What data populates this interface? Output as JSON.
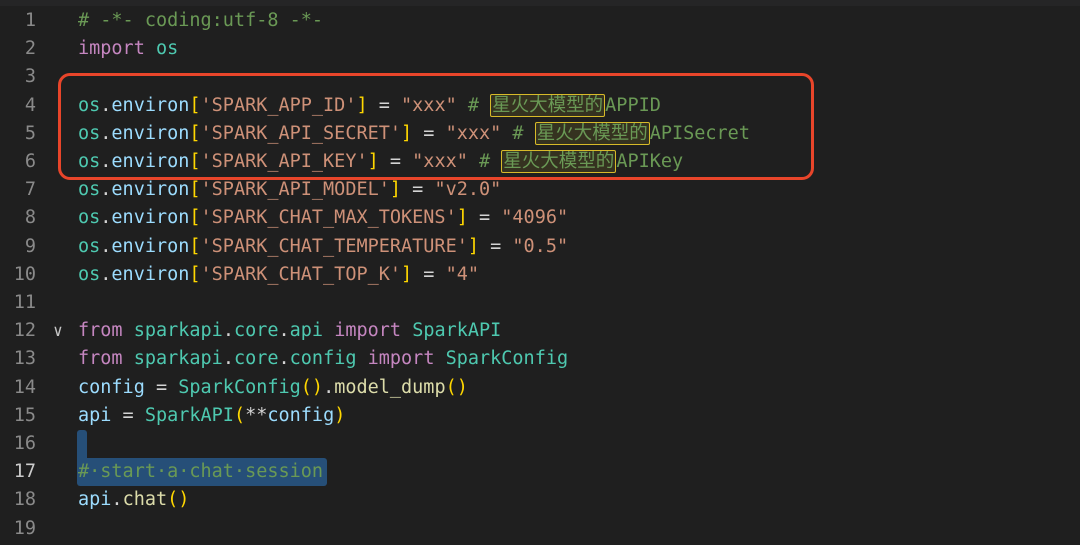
{
  "editor": {
    "lines": [
      {
        "num": "1",
        "tokens": [
          {
            "t": "# -*- coding:utf-8 -*-",
            "c": "cm"
          }
        ]
      },
      {
        "num": "2",
        "tokens": [
          {
            "t": "import",
            "c": "kw"
          },
          {
            "t": " ",
            "c": "op"
          },
          {
            "t": "os",
            "c": "cls"
          }
        ]
      },
      {
        "num": "3",
        "tokens": []
      },
      {
        "num": "4",
        "tokens": [
          {
            "t": "os",
            "c": "cls"
          },
          {
            "t": ".",
            "c": "op"
          },
          {
            "t": "environ",
            "c": "id"
          },
          {
            "t": "[",
            "c": "br1"
          },
          {
            "t": "'SPARK_APP_ID'",
            "c": "str"
          },
          {
            "t": "]",
            "c": "br1"
          },
          {
            "t": " = ",
            "c": "op"
          },
          {
            "t": "\"xxx\"",
            "c": "str"
          },
          {
            "t": " # ",
            "c": "cm"
          },
          {
            "t": "星火大模型的",
            "c": "cm hl"
          },
          {
            "t": "APPID",
            "c": "cm"
          }
        ]
      },
      {
        "num": "5",
        "tokens": [
          {
            "t": "os",
            "c": "cls"
          },
          {
            "t": ".",
            "c": "op"
          },
          {
            "t": "environ",
            "c": "id"
          },
          {
            "t": "[",
            "c": "br1"
          },
          {
            "t": "'SPARK_API_SECRET'",
            "c": "str"
          },
          {
            "t": "]",
            "c": "br1"
          },
          {
            "t": " = ",
            "c": "op"
          },
          {
            "t": "\"xxx\"",
            "c": "str"
          },
          {
            "t": " # ",
            "c": "cm"
          },
          {
            "t": "星火大模型的",
            "c": "cm hl"
          },
          {
            "t": "APISecret",
            "c": "cm"
          }
        ]
      },
      {
        "num": "6",
        "tokens": [
          {
            "t": "os",
            "c": "cls"
          },
          {
            "t": ".",
            "c": "op"
          },
          {
            "t": "environ",
            "c": "id"
          },
          {
            "t": "[",
            "c": "br1"
          },
          {
            "t": "'SPARK_API_KEY'",
            "c": "str"
          },
          {
            "t": "]",
            "c": "br1"
          },
          {
            "t": " = ",
            "c": "op"
          },
          {
            "t": "\"xxx\"",
            "c": "str"
          },
          {
            "t": " # ",
            "c": "cm"
          },
          {
            "t": "星火大模型的",
            "c": "cm hl"
          },
          {
            "t": "APIKey",
            "c": "cm"
          }
        ]
      },
      {
        "num": "7",
        "tokens": [
          {
            "t": "os",
            "c": "cls"
          },
          {
            "t": ".",
            "c": "op"
          },
          {
            "t": "environ",
            "c": "id"
          },
          {
            "t": "[",
            "c": "br1"
          },
          {
            "t": "'SPARK_API_MODEL'",
            "c": "str"
          },
          {
            "t": "]",
            "c": "br1"
          },
          {
            "t": " = ",
            "c": "op"
          },
          {
            "t": "\"v2.0\"",
            "c": "str"
          }
        ]
      },
      {
        "num": "8",
        "tokens": [
          {
            "t": "os",
            "c": "cls"
          },
          {
            "t": ".",
            "c": "op"
          },
          {
            "t": "environ",
            "c": "id"
          },
          {
            "t": "[",
            "c": "br1"
          },
          {
            "t": "'SPARK_CHAT_MAX_TOKENS'",
            "c": "str"
          },
          {
            "t": "]",
            "c": "br1"
          },
          {
            "t": " = ",
            "c": "op"
          },
          {
            "t": "\"4096\"",
            "c": "str"
          }
        ]
      },
      {
        "num": "9",
        "tokens": [
          {
            "t": "os",
            "c": "cls"
          },
          {
            "t": ".",
            "c": "op"
          },
          {
            "t": "environ",
            "c": "id"
          },
          {
            "t": "[",
            "c": "br1"
          },
          {
            "t": "'SPARK_CHAT_TEMPERATURE'",
            "c": "str"
          },
          {
            "t": "]",
            "c": "br1"
          },
          {
            "t": " = ",
            "c": "op"
          },
          {
            "t": "\"0.5\"",
            "c": "str"
          }
        ]
      },
      {
        "num": "10",
        "tokens": [
          {
            "t": "os",
            "c": "cls"
          },
          {
            "t": ".",
            "c": "op"
          },
          {
            "t": "environ",
            "c": "id"
          },
          {
            "t": "[",
            "c": "br1"
          },
          {
            "t": "'SPARK_CHAT_TOP_K'",
            "c": "str"
          },
          {
            "t": "]",
            "c": "br1"
          },
          {
            "t": " = ",
            "c": "op"
          },
          {
            "t": "\"4\"",
            "c": "str"
          }
        ]
      },
      {
        "num": "11",
        "tokens": []
      },
      {
        "num": "12",
        "fold": "∨",
        "tokens": [
          {
            "t": "from",
            "c": "kw"
          },
          {
            "t": " ",
            "c": "op"
          },
          {
            "t": "sparkapi",
            "c": "cls"
          },
          {
            "t": ".",
            "c": "op"
          },
          {
            "t": "core",
            "c": "cls"
          },
          {
            "t": ".",
            "c": "op"
          },
          {
            "t": "api",
            "c": "cls"
          },
          {
            "t": " ",
            "c": "op"
          },
          {
            "t": "import",
            "c": "kw"
          },
          {
            "t": " ",
            "c": "op"
          },
          {
            "t": "SparkAPI",
            "c": "cls"
          }
        ]
      },
      {
        "num": "13",
        "tokens": [
          {
            "t": "from",
            "c": "kw"
          },
          {
            "t": " ",
            "c": "op"
          },
          {
            "t": "sparkapi",
            "c": "cls"
          },
          {
            "t": ".",
            "c": "op"
          },
          {
            "t": "core",
            "c": "cls"
          },
          {
            "t": ".",
            "c": "op"
          },
          {
            "t": "config",
            "c": "cls"
          },
          {
            "t": " ",
            "c": "op"
          },
          {
            "t": "import",
            "c": "kw"
          },
          {
            "t": " ",
            "c": "op"
          },
          {
            "t": "SparkConfig",
            "c": "cls"
          }
        ]
      },
      {
        "num": "14",
        "tokens": [
          {
            "t": "config",
            "c": "id"
          },
          {
            "t": " = ",
            "c": "op"
          },
          {
            "t": "SparkConfig",
            "c": "cls"
          },
          {
            "t": "()",
            "c": "br1"
          },
          {
            "t": ".",
            "c": "op"
          },
          {
            "t": "model_dump",
            "c": "fn"
          },
          {
            "t": "()",
            "c": "br1"
          }
        ]
      },
      {
        "num": "15",
        "tokens": [
          {
            "t": "api",
            "c": "id"
          },
          {
            "t": " = ",
            "c": "op"
          },
          {
            "t": "SparkAPI",
            "c": "cls"
          },
          {
            "t": "(",
            "c": "br1"
          },
          {
            "t": "**",
            "c": "op"
          },
          {
            "t": "config",
            "c": "id"
          },
          {
            "t": ")",
            "c": "br1"
          }
        ]
      },
      {
        "num": "16",
        "tokens": []
      },
      {
        "num": "17",
        "active": true,
        "tokens": [
          {
            "t": "#·start·a·chat·session",
            "c": "cm"
          }
        ]
      },
      {
        "num": "18",
        "tokens": [
          {
            "t": "api",
            "c": "id"
          },
          {
            "t": ".",
            "c": "op"
          },
          {
            "t": "chat",
            "c": "fn"
          },
          {
            "t": "()",
            "c": "br1"
          }
        ]
      },
      {
        "num": "19",
        "tokens": []
      }
    ]
  }
}
